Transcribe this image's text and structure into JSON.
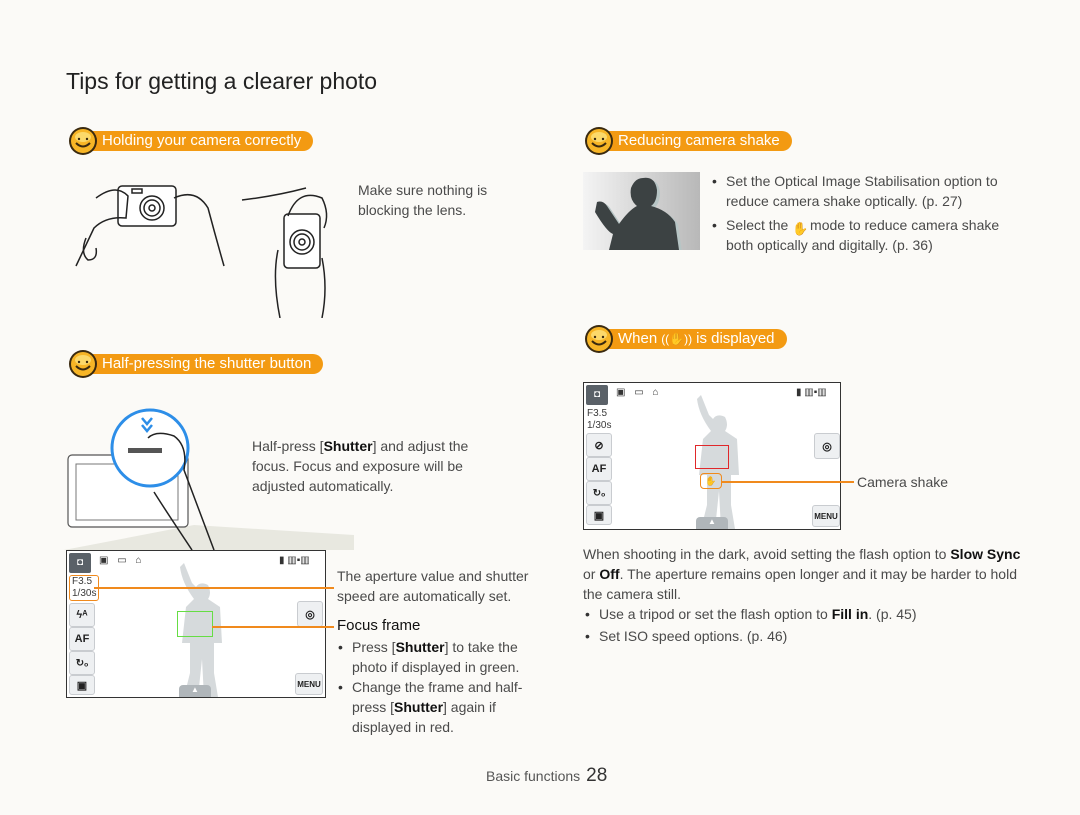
{
  "page": {
    "title": "Tips for getting a clearer photo",
    "footer_section": "Basic functions",
    "page_number": "28"
  },
  "colors": {
    "background": "#fbfaf7",
    "accent_orange": "#f39a12",
    "focus_green": "#66dd44",
    "focus_red": "#e0282a",
    "shutter_blue": "#2d8ee8"
  },
  "holding": {
    "heading": "Holding your camera correctly",
    "text": "Make sure nothing is blocking the lens."
  },
  "half_press": {
    "heading": "Half-pressing the shutter button",
    "text_pre": "Half-press [",
    "text_key": "Shutter",
    "text_post": "] and adjust the focus. Focus and exposure will be adjusted automatically.",
    "screen": {
      "aperture": "F3.5",
      "shutter_speed": "1/30s",
      "left_buttons": [
        "flash-auto-icon",
        "af-icon",
        "timer-off-icon",
        "photo-settings-icon"
      ],
      "af_label": "AF",
      "menu_label": "MENU"
    },
    "callout_aperture": "The aperture value and shutter speed are automatically set.",
    "callout_focus_title": "Focus frame",
    "focus_bullets": [
      {
        "pre": "Press [",
        "key": "Shutter",
        "post": "] to take the photo if displayed in green."
      },
      {
        "pre": "Change the frame and half-press [",
        "key": "Shutter",
        "post": "] again if displayed in red."
      }
    ]
  },
  "reducing": {
    "heading": "Reducing camera shake",
    "bullets": [
      {
        "text": "Set the Optical Image Stabilisation option to reduce camera shake optically. (p. 27)"
      },
      {
        "pre": "Select the ",
        "icon": "dual-is-hand-icon",
        "post": " mode to reduce camera shake both optically and digitally. (p. 36)"
      }
    ]
  },
  "when_displayed": {
    "heading_pre": "When",
    "heading_icon": "shake-warning-hand-icon",
    "heading_post": "is displayed",
    "screen": {
      "aperture": "F3.5",
      "shutter_speed": "1/30s",
      "af_label": "AF",
      "menu_label": "MENU"
    },
    "callout_shake": "Camera shake",
    "paragraph": [
      {
        "t": "When shooting in the dark, avoid setting the flash option to "
      },
      {
        "b": "Slow Sync"
      },
      {
        "t": " or "
      },
      {
        "b": "Off"
      },
      {
        "t": ". The aperture remains open longer and it may be harder to hold the camera still."
      }
    ],
    "bullets": [
      {
        "pre": "Use a tripod or set the flash option to ",
        "key": "Fill in",
        "post": ". (p. 45)"
      },
      {
        "pre": "Set ISO speed options. (p. 46)",
        "key": "",
        "post": ""
      }
    ]
  }
}
